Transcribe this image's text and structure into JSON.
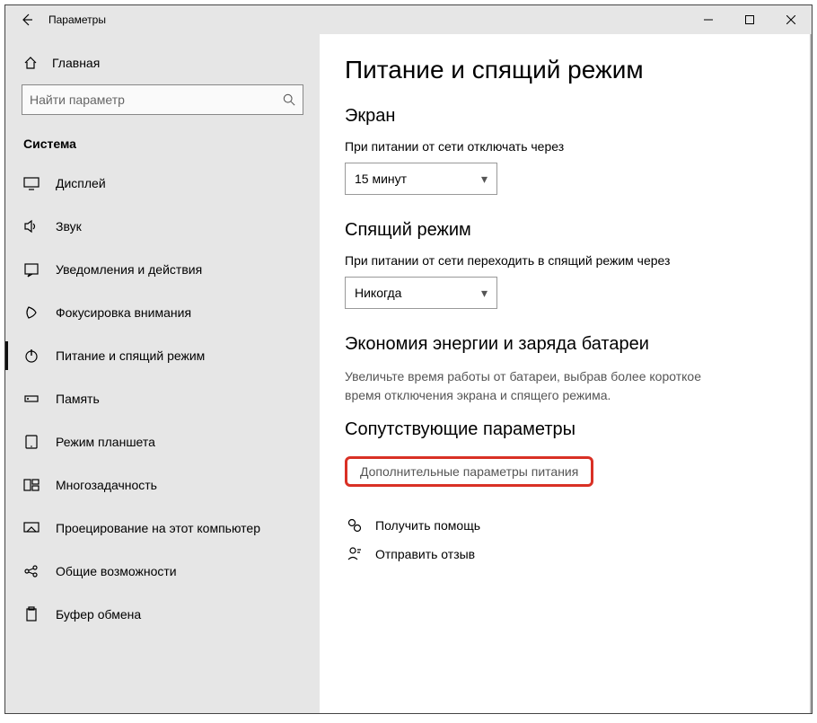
{
  "window": {
    "title": "Параметры"
  },
  "sidebar": {
    "home_label": "Главная",
    "search_placeholder": "Найти параметр",
    "group_label": "Система",
    "items": [
      {
        "icon": "display",
        "label": "Дисплей"
      },
      {
        "icon": "sound",
        "label": "Звук"
      },
      {
        "icon": "notify",
        "label": "Уведомления и действия"
      },
      {
        "icon": "focus",
        "label": "Фокусировка внимания"
      },
      {
        "icon": "power",
        "label": "Питание и спящий режим",
        "selected": true
      },
      {
        "icon": "storage",
        "label": "Память"
      },
      {
        "icon": "tablet",
        "label": "Режим планшета"
      },
      {
        "icon": "multitask",
        "label": "Многозадачность"
      },
      {
        "icon": "projecting",
        "label": "Проецирование на этот компьютер"
      },
      {
        "icon": "shared",
        "label": "Общие возможности"
      },
      {
        "icon": "clipboard",
        "label": "Буфер обмена"
      }
    ]
  },
  "content": {
    "page_title": "Питание и спящий режим",
    "screen_section": "Экран",
    "screen_label": "При питании от сети отключать через",
    "screen_value": "15 минут",
    "sleep_section": "Спящий режим",
    "sleep_label": "При питании от сети переходить в спящий режим через",
    "sleep_value": "Никогда",
    "battery_section": "Экономия энергии и заряда батареи",
    "battery_desc": "Увеличьте время работы от батареи, выбрав более короткое время отключения экрана и спящего режима.",
    "related_section": "Сопутствующие параметры",
    "related_link": "Дополнительные параметры питания",
    "help_link": "Получить помощь",
    "feedback_link": "Отправить отзыв"
  }
}
